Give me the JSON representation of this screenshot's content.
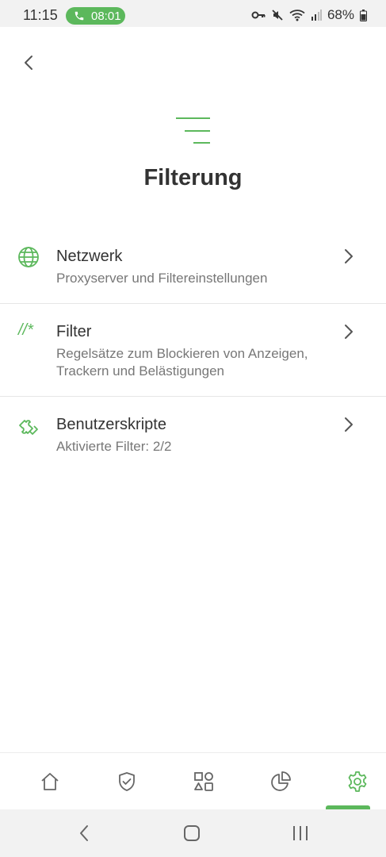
{
  "status_bar": {
    "time": "11:15",
    "call_timer": "08:01",
    "battery": "68%",
    "icons": [
      "key-icon",
      "mute-icon",
      "wifi-icon",
      "signal-icon",
      "battery-icon"
    ]
  },
  "header": {
    "back_icon": "chevron-left-icon",
    "hero_icon": "filter-lines-icon",
    "title": "Filterung"
  },
  "items": [
    {
      "icon": "globe-icon",
      "title": "Netzwerk",
      "subtitle": "Proxyserver und Filtereinstellungen"
    },
    {
      "icon": "filter-syntax-icon",
      "icon_text": "//*",
      "title": "Filter",
      "subtitle_line1": "Regelsätze zum Blockieren von Anzeigen,",
      "subtitle_line2": "Trackern und Belästigungen"
    },
    {
      "icon": "puzzle-icon",
      "title": "Benutzerskripte",
      "subtitle": "Aktivierte Filter: 2/2"
    }
  ],
  "bottom_nav": {
    "items": [
      "home-icon",
      "shield-check-icon",
      "apps-icon",
      "pie-chart-icon",
      "settings-icon"
    ],
    "active": "settings-icon"
  },
  "colors": {
    "accent": "#5cb85c",
    "text_primary": "#333333",
    "text_secondary": "#777777",
    "icon_gray": "#666666"
  }
}
